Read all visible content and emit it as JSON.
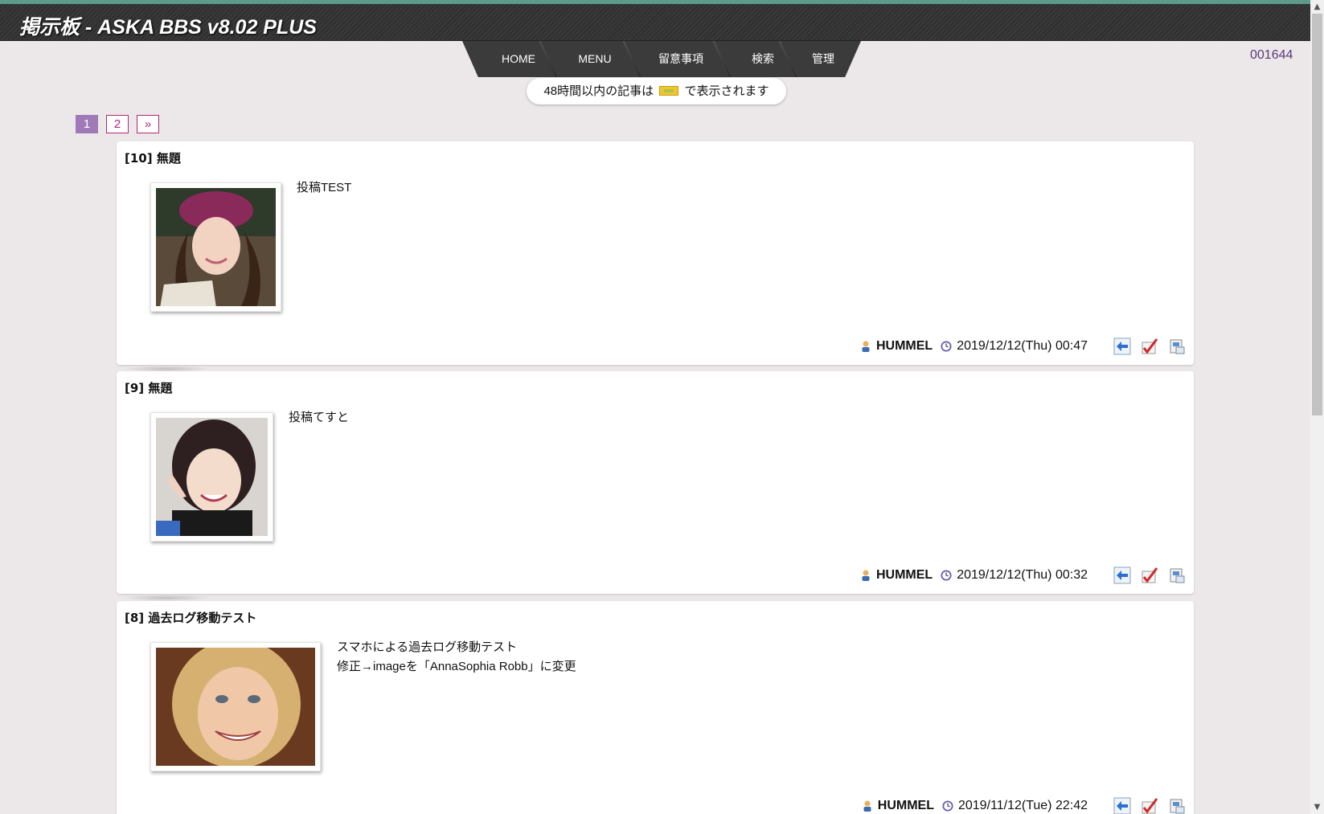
{
  "header": {
    "title": "掲示板 - ASKA BBS v8.02 PLUS"
  },
  "nav": {
    "items": [
      {
        "label": "HOME"
      },
      {
        "label": "MENU"
      },
      {
        "label": "留意事項"
      },
      {
        "label": "検索"
      },
      {
        "label": "管理"
      }
    ]
  },
  "counter": "001644",
  "notice": {
    "before": "48時間以内の記事は",
    "after": "で表示されます"
  },
  "pager": {
    "pages": [
      "1",
      "2"
    ],
    "next": "»",
    "current": "1"
  },
  "posts": [
    {
      "number": "[10]",
      "title": "無題",
      "body": [
        "投稿TEST"
      ],
      "author": "HUMMEL",
      "date": "2019/12/12(Thu) 00:47"
    },
    {
      "number": "[9]",
      "title": "無題",
      "body": [
        "投稿てすと"
      ],
      "author": "HUMMEL",
      "date": "2019/12/12(Thu) 00:32"
    },
    {
      "number": "[8]",
      "title": "過去ログ移動テスト",
      "body": [
        "スマホによる過去ログ移動テスト",
        "修正→imageを「AnnaSophia Robb」に変更"
      ],
      "author": "HUMMEL",
      "date": "2019/11/12(Tue) 22:42"
    }
  ],
  "icons": {
    "author": "user-icon",
    "date": "clock-icon",
    "actions": [
      "reply-icon",
      "edit-icon",
      "delete-icon"
    ]
  },
  "colors": {
    "accent": "#b0287a",
    "current_page": "#a07ab8",
    "counter": "#5a3a7a"
  }
}
